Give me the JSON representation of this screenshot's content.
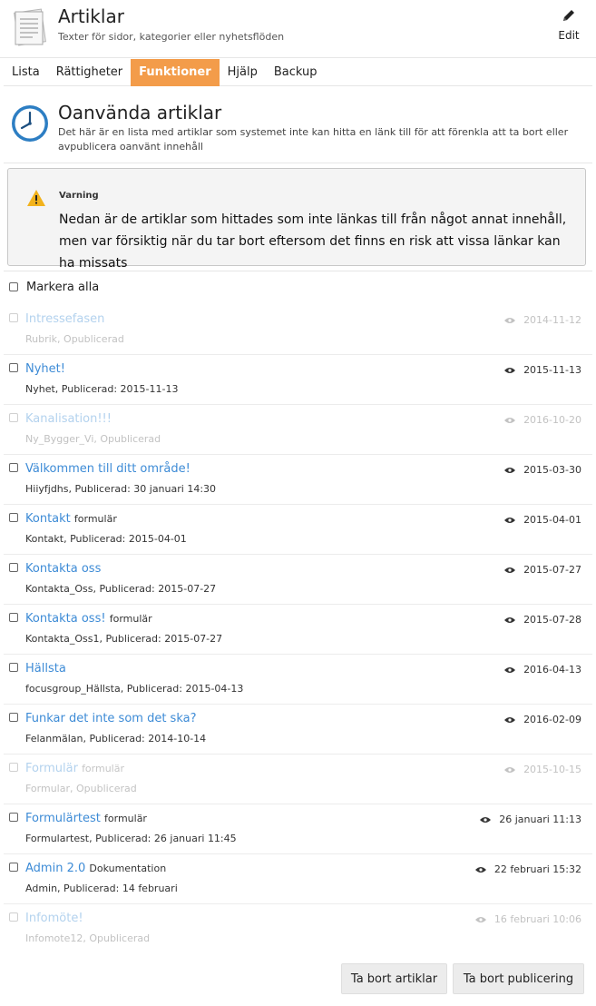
{
  "header": {
    "title": "Artiklar",
    "subtitle": "Texter för sidor, kategorier eller nyhetsflöden",
    "edit_label": "Edit",
    "icon": "document-stack-icon"
  },
  "tabs": [
    {
      "label": "Lista",
      "active": false
    },
    {
      "label": "Rättigheter",
      "active": false
    },
    {
      "label": "Funktioner",
      "active": true
    },
    {
      "label": "Hjälp",
      "active": false
    },
    {
      "label": "Backup",
      "active": false
    }
  ],
  "section": {
    "title": "Oanvända artiklar",
    "description": "Det här är en lista med artiklar som systemet inte kan hitta en länk till för att förenkla att ta bort eller avpublicera oanvänt innehåll",
    "icon": "clock-icon"
  },
  "warning": {
    "title": "Varning",
    "text": "Nedan är de artiklar som hittades som inte länkas till från något annat innehåll, men var försiktig när du tar bort eftersom det finns en risk att vissa länkar kan ha missats",
    "icon": "warning-triangle-icon"
  },
  "select_all_label": "Markera alla",
  "articles": [
    {
      "title": "Intressefasen",
      "tag": "",
      "sub": "Rubrik, Opublicerad",
      "date": "2014-11-12",
      "faded": true
    },
    {
      "title": "Nyhet!",
      "tag": "",
      "sub": "Nyhet, Publicerad: 2015-11-13",
      "date": "2015-11-13",
      "faded": false
    },
    {
      "title": "Kanalisation!!!",
      "tag": "",
      "sub": "Ny_Bygger_Vi, Opublicerad",
      "date": "2016-10-20",
      "faded": true
    },
    {
      "title": "Välkommen till ditt område!",
      "tag": "",
      "sub": "Hiiyfjdhs, Publicerad: 30 januari 14:30",
      "date": "2015-03-30",
      "faded": false
    },
    {
      "title": "Kontakt",
      "tag": "formulär",
      "sub": "Kontakt, Publicerad: 2015-04-01",
      "date": "2015-04-01",
      "faded": false
    },
    {
      "title": "Kontakta oss",
      "tag": "",
      "sub": "Kontakta_Oss, Publicerad: 2015-07-27",
      "date": "2015-07-27",
      "faded": false
    },
    {
      "title": "Kontakta oss!",
      "tag": "formulär",
      "sub": "Kontakta_Oss1, Publicerad: 2015-07-27",
      "date": "2015-07-28",
      "faded": false
    },
    {
      "title": "Hällsta",
      "tag": "",
      "sub": "focusgroup_Hällsta, Publicerad: 2015-04-13",
      "date": "2016-04-13",
      "faded": false
    },
    {
      "title": "Funkar det inte som det ska?",
      "tag": "",
      "sub": "Felanmälan, Publicerad: 2014-10-14",
      "date": "2016-02-09",
      "faded": false
    },
    {
      "title": "Formulär",
      "tag": "formulär",
      "sub": "Formular, Opublicerad",
      "date": "2015-10-15",
      "faded": true
    },
    {
      "title": "Formulärtest",
      "tag": "formulär",
      "sub": "Formulartest, Publicerad: 26 januari 11:45",
      "date": "26 januari 11:13",
      "faded": false
    },
    {
      "title": "Admin 2.0",
      "tag": "Dokumentation",
      "sub": "Admin, Publicerad: 14 februari",
      "date": "22 februari 15:32",
      "faded": false
    },
    {
      "title": "Infomöte!",
      "tag": "",
      "sub": "Infomote12, Opublicerad",
      "date": "16 februari 10:06",
      "faded": true
    }
  ],
  "buttons": {
    "delete_label": "Ta bort artiklar",
    "unpublish_label": "Ta bort publicering"
  },
  "colors": {
    "accent": "#f39c4a",
    "link": "#3d8bd6"
  }
}
